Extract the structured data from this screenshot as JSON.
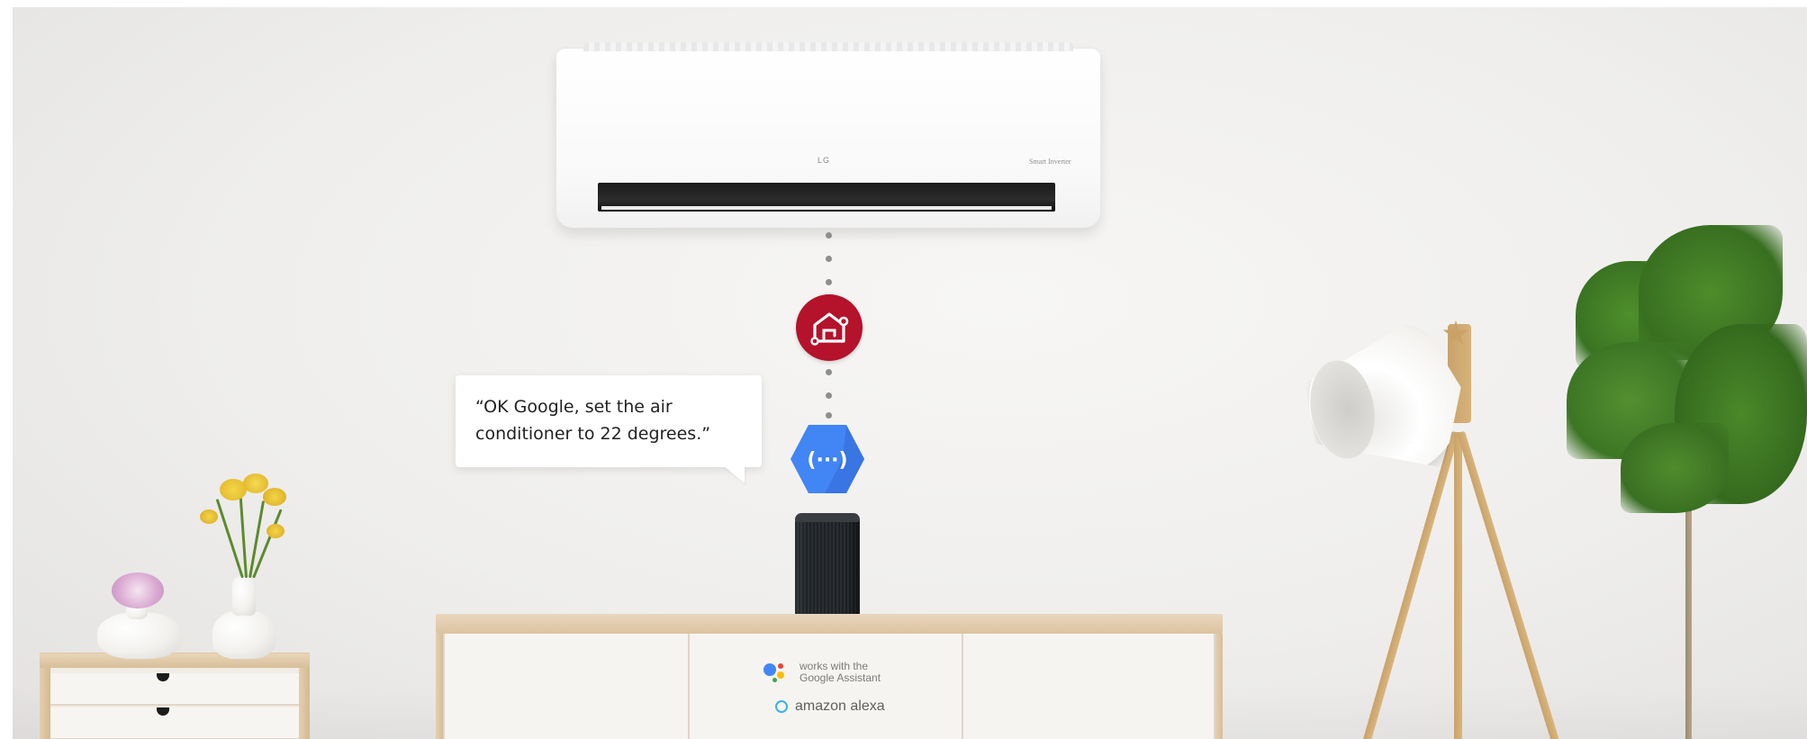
{
  "scene": {
    "speech_bubble": {
      "text": "“OK Google, set the air conditioner to 22 degrees.”"
    },
    "air_conditioner": {
      "logo": "LG",
      "model_text": "Smart Inverter"
    },
    "icons": {
      "thinq_home": "home-icon",
      "google_actions": "actions-on-google-icon",
      "speaker": "smart-speaker"
    },
    "sideboard_labels": {
      "works_with_line1": "works with the",
      "works_with_line2": "Google Assistant",
      "alexa": "amazon alexa"
    },
    "colors": {
      "thinq_red": "#b5122b",
      "google_blue": "#4285f4",
      "alexa_cyan": "#39b4e4",
      "wood": "#dcc3a1"
    }
  }
}
